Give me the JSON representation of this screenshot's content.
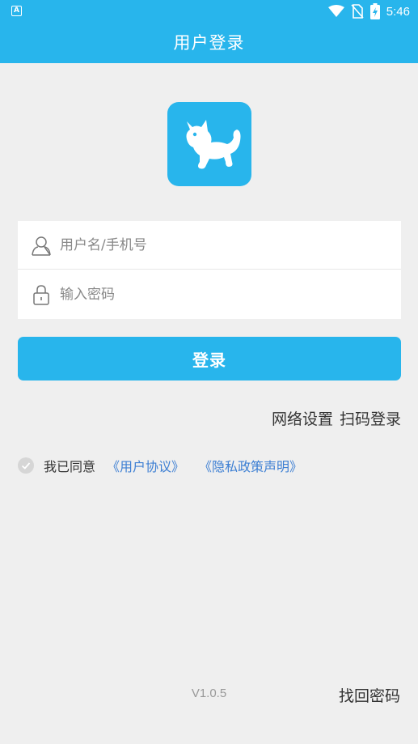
{
  "status_bar": {
    "left_badge": "A",
    "time": "5:46",
    "icons": [
      "wifi-icon",
      "no-sim-icon",
      "battery-charging-icon"
    ]
  },
  "header": {
    "title": "用户登录"
  },
  "logo": {
    "icon": "cat-logo-icon",
    "color": "#28b5ec"
  },
  "form": {
    "username": {
      "value": "",
      "placeholder": "用户名/手机号",
      "icon": "user-icon"
    },
    "password": {
      "value": "",
      "placeholder": "输入密码",
      "icon": "lock-icon"
    }
  },
  "login_button": {
    "label": "登录"
  },
  "links": {
    "network_settings": "网络设置",
    "scan_login": "扫码登录"
  },
  "agreement": {
    "checked": false,
    "text": "我已同意",
    "user_agreement": "《用户协议》",
    "privacy_policy": "《隐私政策声明》"
  },
  "footer": {
    "version": "V1.0.5",
    "forgot_password": "找回密码"
  },
  "colors": {
    "primary": "#28b5ec",
    "link": "#3d7fd3",
    "background": "#efefef"
  }
}
